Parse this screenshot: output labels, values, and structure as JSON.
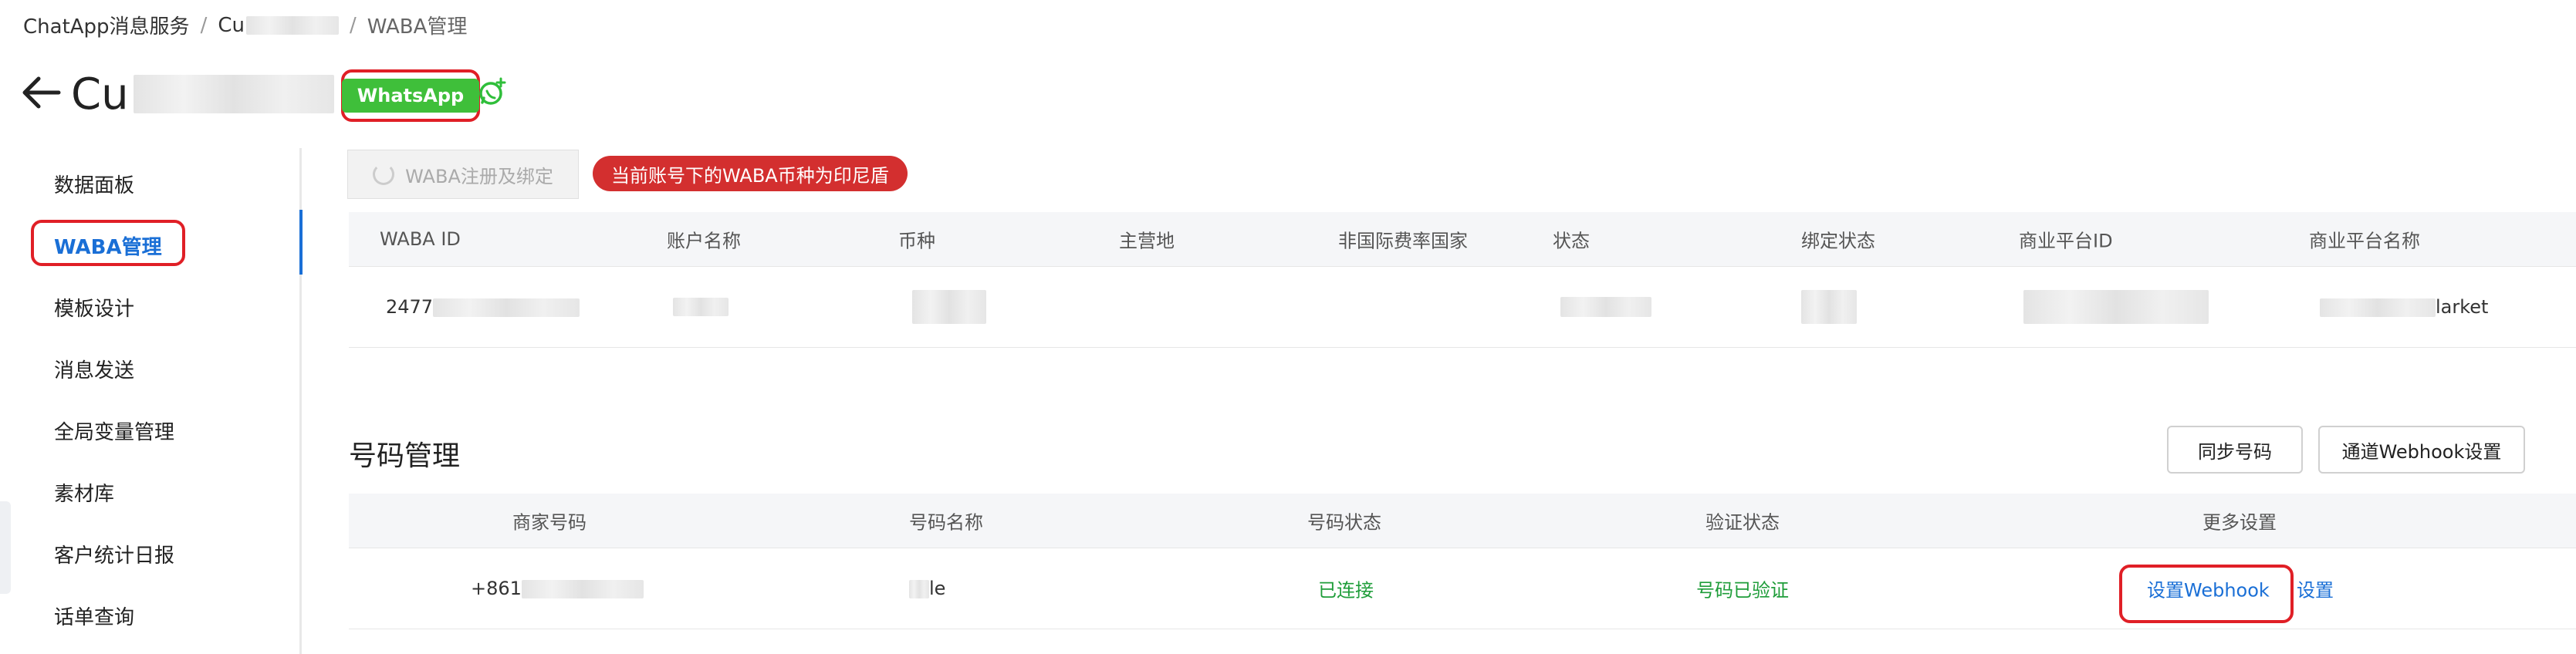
{
  "breadcrumb": {
    "root": "ChatApp消息服务",
    "sep": "/",
    "middle": "Cu",
    "current": "WABA管理"
  },
  "header": {
    "back_icon": "arrow-left-icon",
    "title": "Cu",
    "badge": "WhatsApp",
    "whatsapp_icon": "whatsapp-add-icon"
  },
  "sidebar": {
    "items": [
      {
        "label": "数据面板"
      },
      {
        "label": "WABA管理"
      },
      {
        "label": "模板设计"
      },
      {
        "label": "消息发送"
      },
      {
        "label": "全局变量管理"
      },
      {
        "label": "素材库"
      },
      {
        "label": "客户统计日报"
      },
      {
        "label": "话单查询"
      }
    ],
    "active_color": "#1a6fd6"
  },
  "waba": {
    "register_button": "WABA注册及绑定",
    "currency_notice": "当前账号下的WABA币种为印尼盾",
    "columns": [
      "WABA ID",
      "账户名称",
      "币种",
      "主营地",
      "非国际费率国家",
      "状态",
      "绑定状态",
      "商业平台ID",
      "商业平台名称"
    ],
    "row": {
      "waba_id": "2477",
      "platform_name": "larket"
    }
  },
  "numbers": {
    "section_title": "号码管理",
    "sync_button": "同步号码",
    "channel_webhook_button": "通道Webhook设置",
    "columns": [
      "商家号码",
      "号码名称",
      "号码状态",
      "验证状态",
      "更多设置"
    ],
    "row": {
      "phone": "+861",
      "name_suffix": "le",
      "status": "已连接",
      "verify": "号码已验证",
      "set_webhook": "设置Webhook",
      "settings": "设置"
    }
  },
  "colors": {
    "accent": "#1a6fd6",
    "highlight": "#e01f26",
    "success": "#1f9d3a",
    "badge": "#3fbf3a"
  }
}
